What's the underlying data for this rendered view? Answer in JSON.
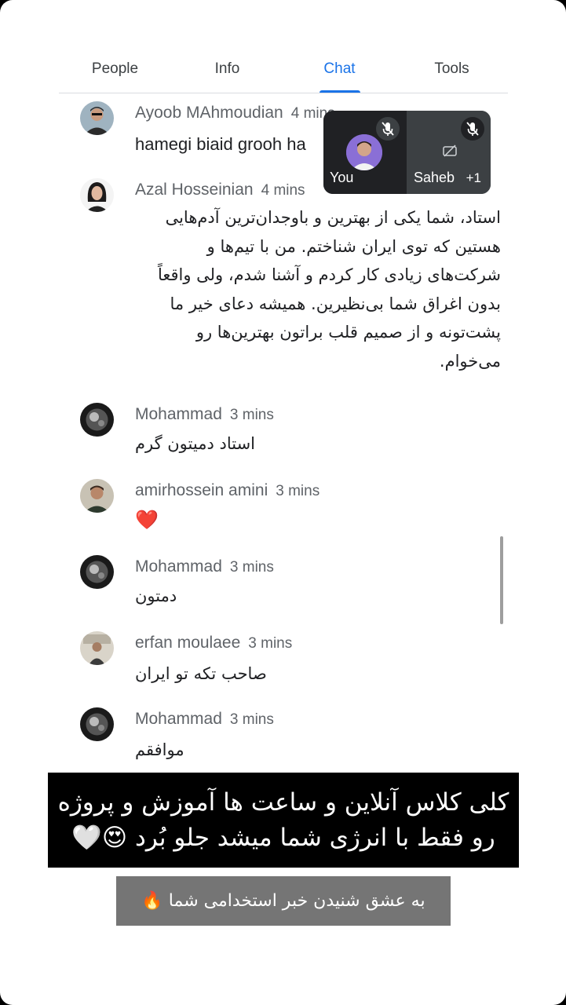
{
  "tabs": [
    {
      "label": "People",
      "active": false
    },
    {
      "label": "Info",
      "active": false
    },
    {
      "label": "Chat",
      "active": true
    },
    {
      "label": "Tools",
      "active": false
    }
  ],
  "accent_color": "#1a73e8",
  "messages": [
    {
      "sender": "Ayoob MAhmoudian",
      "time": "4 mins",
      "text": "hamegi biaid grooh ha"
    },
    {
      "sender": "Azal Hosseinian",
      "time": "4 mins",
      "text": "استاد، شما یکی از بهترین و باوجدان‌ترین آدم‌هایی هستین که توی ایران شناختم. من با تیم‌ها و شرکت‌های زیادی کار کردم و آشنا شدم، ولی واقعاً بدون اغراق شما بی‌نظیرین. همیشه دعای خیر ما پشت‌تونه و از صمیم قلب براتون بهترین‌ها رو می‌خوام."
    },
    {
      "sender": "Mohammad",
      "time": "3 mins",
      "text": "استاد دمیتون گرم"
    },
    {
      "sender": "amirhossein amini",
      "time": "3 mins",
      "text": "❤️"
    },
    {
      "sender": "Mohammad",
      "time": "3 mins",
      "text": "دمتون"
    },
    {
      "sender": "erfan moulaee",
      "time": "3 mins",
      "text": "صاحب تکه تو ایران"
    },
    {
      "sender": "Mohammad",
      "time": "3 mins",
      "text": "موافقم"
    }
  ],
  "video": {
    "self_label": "You",
    "other_label": "Saheb",
    "extra_count": "+1"
  },
  "captions": {
    "black_line1": "کلی کلاس آنلاین و ساعت ها آموزش و پروژه",
    "black_line2": "رو فقط با انرژی شما میشد جلو بُرد 😍🤍",
    "gray": "به عشق شنیدن خبر استخدامی شما 🔥"
  }
}
